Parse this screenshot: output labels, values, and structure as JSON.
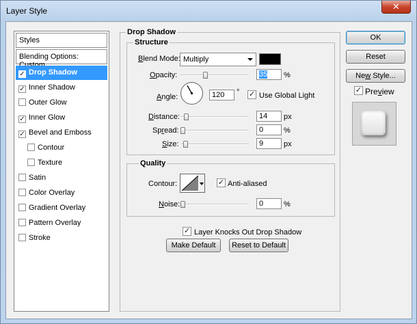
{
  "window": {
    "title": "Layer Style",
    "close_glyph": "✕"
  },
  "styles_list": {
    "header": "Styles",
    "blending_options": "Blending Options: Custom",
    "items": [
      {
        "label": "Drop Shadow",
        "checked": true,
        "selected": true,
        "sub": false
      },
      {
        "label": "Inner Shadow",
        "checked": true,
        "selected": false,
        "sub": false
      },
      {
        "label": "Outer Glow",
        "checked": false,
        "selected": false,
        "sub": false
      },
      {
        "label": "Inner Glow",
        "checked": true,
        "selected": false,
        "sub": false
      },
      {
        "label": "Bevel and Emboss",
        "checked": true,
        "selected": false,
        "sub": false
      },
      {
        "label": "Contour",
        "checked": false,
        "selected": false,
        "sub": true
      },
      {
        "label": "Texture",
        "checked": false,
        "selected": false,
        "sub": true
      },
      {
        "label": "Satin",
        "checked": false,
        "selected": false,
        "sub": false
      },
      {
        "label": "Color Overlay",
        "checked": false,
        "selected": false,
        "sub": false
      },
      {
        "label": "Gradient Overlay",
        "checked": false,
        "selected": false,
        "sub": false
      },
      {
        "label": "Pattern Overlay",
        "checked": false,
        "selected": false,
        "sub": false
      },
      {
        "label": "Stroke",
        "checked": false,
        "selected": false,
        "sub": false
      }
    ]
  },
  "drop_shadow": {
    "title": "Drop Shadow",
    "structure": {
      "title": "Structure",
      "blend_mode_label": "Blend Mode:",
      "blend_mode_value": "Multiply",
      "shadow_color": "#000000",
      "opacity_label": "Opacity:",
      "opacity_value": "35",
      "opacity_unit": "%",
      "opacity_level": 0.35,
      "angle_label": "Angle:",
      "angle_value": "120",
      "angle_unit": "°",
      "use_global_light_label": "Use Global Light",
      "use_global_light": true,
      "distance_label": "Distance:",
      "distance_value": "14",
      "distance_unit": "px",
      "distance_level": 0.05,
      "spread_label": "Spread:",
      "spread_value": "0",
      "spread_unit": "%",
      "spread_level": 0,
      "size_label": "Size:",
      "size_value": "9",
      "size_unit": "px",
      "size_level": 0.04
    },
    "quality": {
      "title": "Quality",
      "contour_label": "Contour:",
      "anti_aliased_label": "Anti-aliased",
      "anti_aliased": true,
      "noise_label": "Noise:",
      "noise_value": "0",
      "noise_unit": "%",
      "noise_level": 0
    },
    "knocks_out_label": "Layer Knocks Out Drop Shadow",
    "knocks_out": true,
    "make_default": "Make Default",
    "reset_to_default": "Reset to Default"
  },
  "buttons": {
    "ok": "OK",
    "reset": "Reset",
    "new_style": "New Style..."
  },
  "preview": {
    "label": "Preview",
    "checked": true
  },
  "colors": {
    "selection": "#3399ff",
    "window_frame": "#bcd3ec"
  }
}
